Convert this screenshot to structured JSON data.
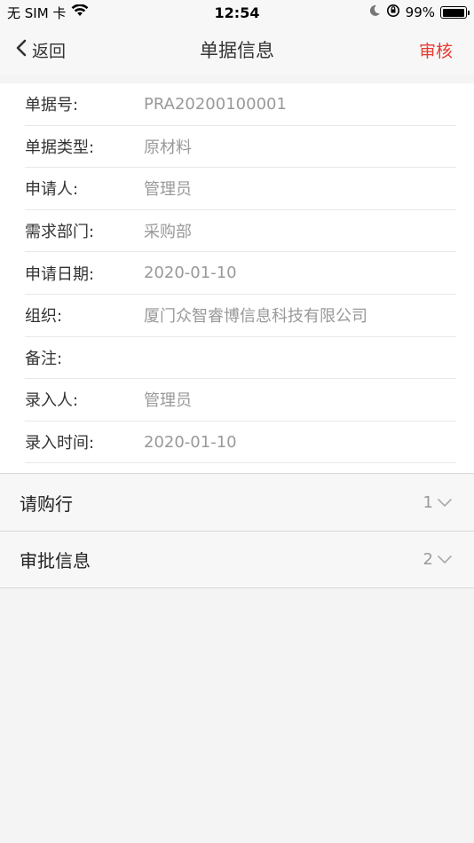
{
  "status_bar": {
    "carrier": "无 SIM 卡",
    "time": "12:54",
    "battery_percent": "99%",
    "battery_level": 0.99
  },
  "nav": {
    "back_label": "返回",
    "title": "单据信息",
    "action_label": "审核"
  },
  "info_rows": [
    {
      "label": "单据号:",
      "value": "PRA20200100001"
    },
    {
      "label": "单据类型:",
      "value": "原材料"
    },
    {
      "label": "申请人:",
      "value": "管理员"
    },
    {
      "label": "需求部门:",
      "value": "采购部"
    },
    {
      "label": "申请日期:",
      "value": "2020-01-10"
    },
    {
      "label": "组织:",
      "value": "厦门众智睿博信息科技有限公司"
    },
    {
      "label": "备注:",
      "value": ""
    },
    {
      "label": "录入人:",
      "value": "管理员"
    },
    {
      "label": "录入时间:",
      "value": "2020-01-10"
    }
  ],
  "sections": [
    {
      "title": "请购行",
      "count": "1"
    },
    {
      "title": "审批信息",
      "count": "2"
    }
  ],
  "colors": {
    "accent": "#e8392f",
    "label": "#333333",
    "value": "#999999"
  }
}
